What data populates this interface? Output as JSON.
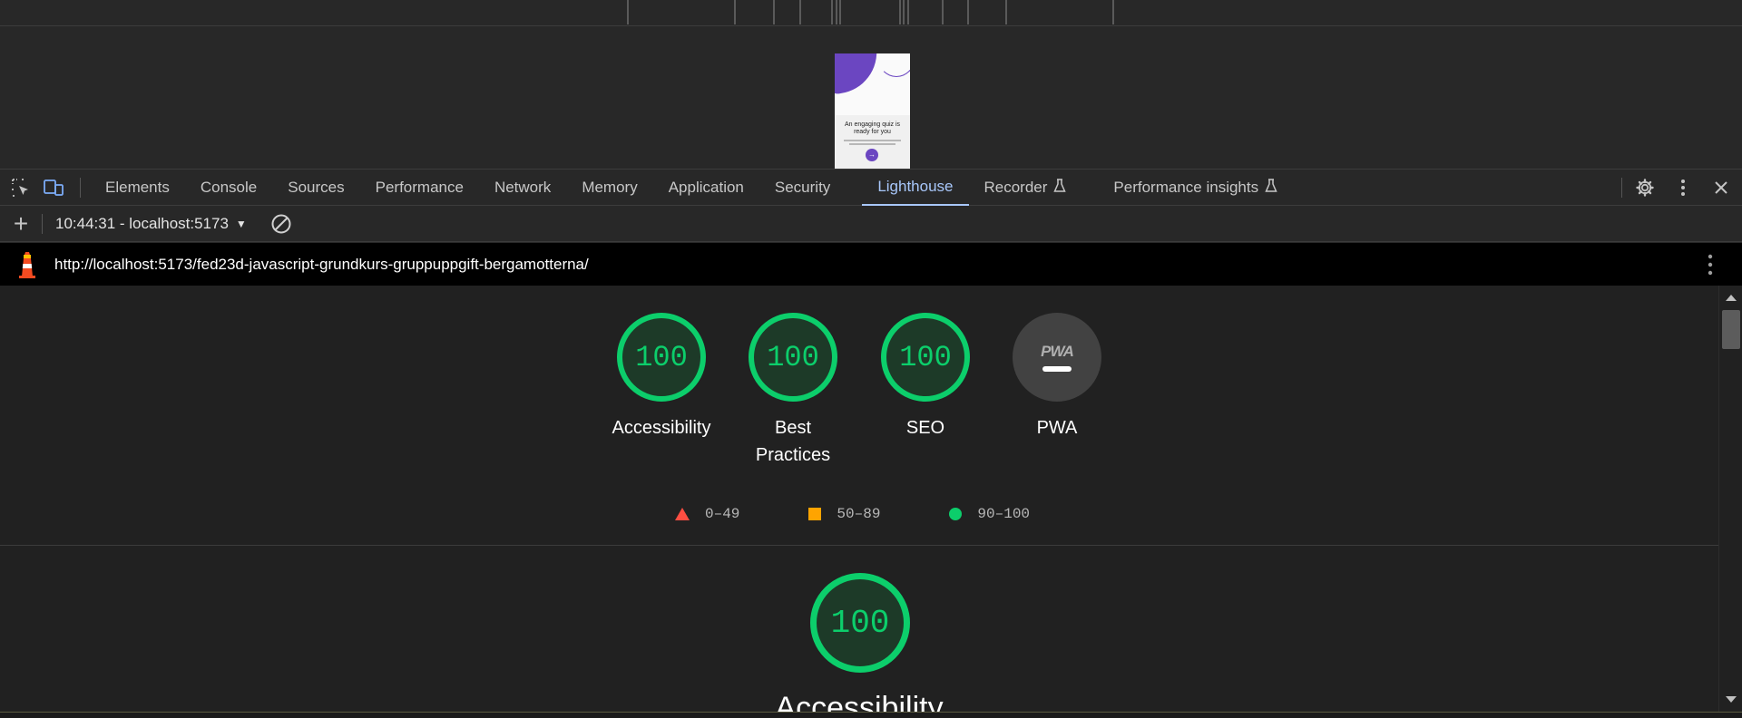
{
  "preview": {
    "title": "An engaging quiz is ready for you"
  },
  "devtools": {
    "tabs": [
      {
        "label": "Elements"
      },
      {
        "label": "Console"
      },
      {
        "label": "Sources"
      },
      {
        "label": "Performance"
      },
      {
        "label": "Network"
      },
      {
        "label": "Memory"
      },
      {
        "label": "Application"
      },
      {
        "label": "Security"
      },
      {
        "label": "Lighthouse"
      },
      {
        "label": "Recorder"
      },
      {
        "label": "Performance insights"
      }
    ],
    "active_tab": "Lighthouse"
  },
  "lighthouse": {
    "report_select": "10:44:31 - localhost:5173",
    "url": "http://localhost:5173/fed23d-javascript-grundkurs-gruppuppgift-bergamotterna/",
    "categories": [
      {
        "label": "Accessibility",
        "score": "100"
      },
      {
        "label": "Best Practices",
        "score": "100"
      },
      {
        "label": "SEO",
        "score": "100"
      },
      {
        "label": "PWA",
        "badge": "PWA"
      }
    ],
    "legend": [
      {
        "range": "0–49",
        "color": "#ff4e42",
        "shape": "triangle"
      },
      {
        "range": "50–89",
        "color": "#ffa400",
        "shape": "square"
      },
      {
        "range": "90–100",
        "color": "#0cce6b",
        "shape": "circle"
      }
    ],
    "section": {
      "score": "100",
      "title": "Accessibility"
    }
  }
}
